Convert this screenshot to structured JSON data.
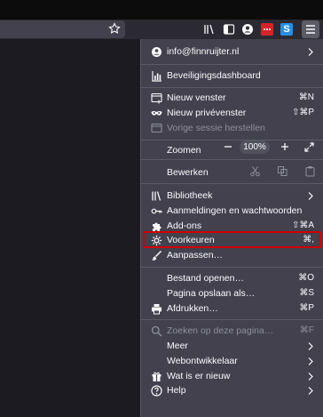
{
  "menu": {
    "account_email": "info@finnruijter.nl",
    "security_dashboard": "Beveiligingsdashboard",
    "new_window": {
      "label": "Nieuw venster",
      "shortcut": "⌘N"
    },
    "private_window": {
      "label": "Nieuw privévenster",
      "shortcut": "⇧⌘P"
    },
    "restore_session": "Vorige sessie herstellen",
    "zoom": {
      "label": "Zoomen",
      "minus": "−",
      "value": "100%",
      "plus": "+"
    },
    "edit": {
      "label": "Bewerken"
    },
    "library": "Bibliotheek",
    "logins": "Aanmeldingen en wachtwoorden",
    "addons": {
      "label": "Add-ons",
      "shortcut": "⇧⌘A"
    },
    "preferences": {
      "label": "Voorkeuren",
      "shortcut": "⌘,"
    },
    "customize": "Aanpassen…",
    "open_file": {
      "label": "Bestand openen…",
      "shortcut": "⌘O"
    },
    "save_page": {
      "label": "Pagina opslaan als…",
      "shortcut": "⌘S"
    },
    "print": {
      "label": "Afdrukken…",
      "shortcut": "⌘P"
    },
    "find": {
      "label": "Zoeken op deze pagina…",
      "shortcut": "⌘F"
    },
    "more": "Meer",
    "web_dev": "Webontwikkelaar",
    "whats_new": "Wat is er nieuw",
    "help": "Help"
  },
  "toolbar": {
    "s_badge": "S"
  },
  "colors": {
    "highlight": "#d00000",
    "panel_bg": "#42414d"
  }
}
